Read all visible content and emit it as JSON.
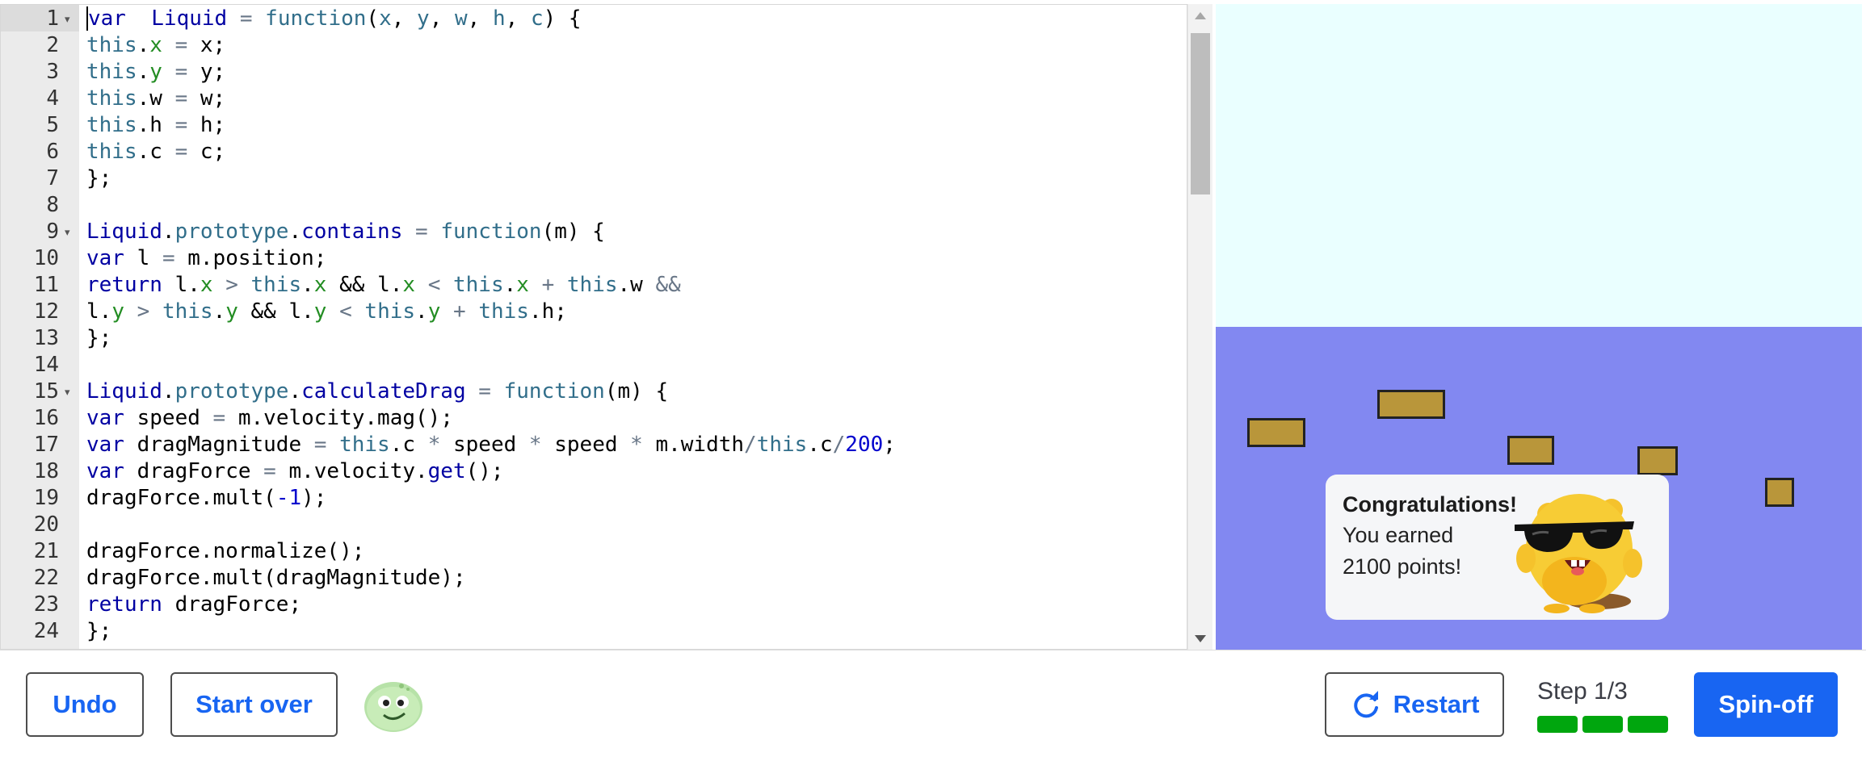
{
  "editor": {
    "lines": [
      {
        "n": "1",
        "fold": true
      },
      {
        "n": "2"
      },
      {
        "n": "3"
      },
      {
        "n": "4"
      },
      {
        "n": "5"
      },
      {
        "n": "6"
      },
      {
        "n": "7"
      },
      {
        "n": "8"
      },
      {
        "n": "9",
        "fold": true
      },
      {
        "n": "10"
      },
      {
        "n": "11"
      },
      {
        "n": "12"
      },
      {
        "n": "13"
      },
      {
        "n": "14"
      },
      {
        "n": "15",
        "fold": true
      },
      {
        "n": "16"
      },
      {
        "n": "17"
      },
      {
        "n": "18"
      },
      {
        "n": "19"
      },
      {
        "n": "20"
      },
      {
        "n": "21"
      },
      {
        "n": "22"
      },
      {
        "n": "23"
      },
      {
        "n": "24"
      }
    ],
    "code": [
      [
        [
          "kw",
          "var"
        ],
        [
          "",
          "  "
        ],
        [
          "fn",
          "Liquid"
        ],
        [
          "",
          " "
        ],
        [
          "op",
          "="
        ],
        [
          "",
          " "
        ],
        [
          "st",
          "function"
        ],
        [
          "",
          "("
        ],
        [
          "st",
          "x"
        ],
        [
          "",
          ", "
        ],
        [
          "st",
          "y"
        ],
        [
          "",
          ", "
        ],
        [
          "st",
          "w"
        ],
        [
          "",
          ", "
        ],
        [
          "st",
          "h"
        ],
        [
          "",
          ", "
        ],
        [
          "st",
          "c"
        ],
        [
          "",
          ") {"
        ]
      ],
      [
        [
          "st",
          "this"
        ],
        [
          "",
          "."
        ],
        [
          "pr",
          "x"
        ],
        [
          "",
          " "
        ],
        [
          "op",
          "="
        ],
        [
          "",
          " x;"
        ]
      ],
      [
        [
          "st",
          "this"
        ],
        [
          "",
          "."
        ],
        [
          "pr",
          "y"
        ],
        [
          "",
          " "
        ],
        [
          "op",
          "="
        ],
        [
          "",
          " y;"
        ]
      ],
      [
        [
          "st",
          "this"
        ],
        [
          "",
          ".w "
        ],
        [
          "op",
          "="
        ],
        [
          "",
          " w;"
        ]
      ],
      [
        [
          "st",
          "this"
        ],
        [
          "",
          ".h "
        ],
        [
          "op",
          "="
        ],
        [
          "",
          " h;"
        ]
      ],
      [
        [
          "st",
          "this"
        ],
        [
          "",
          ".c "
        ],
        [
          "op",
          "="
        ],
        [
          "",
          " c;"
        ]
      ],
      [
        [
          "",
          "};"
        ]
      ],
      [
        [
          "",
          ""
        ]
      ],
      [
        [
          "fn",
          "Liquid"
        ],
        [
          "",
          "."
        ],
        [
          "st",
          "prototype"
        ],
        [
          "",
          "."
        ],
        [
          "fn",
          "contains"
        ],
        [
          "",
          " "
        ],
        [
          "op",
          "="
        ],
        [
          "",
          " "
        ],
        [
          "st",
          "function"
        ],
        [
          "",
          "(m) {"
        ]
      ],
      [
        [
          "kw",
          "var"
        ],
        [
          "",
          " l "
        ],
        [
          "op",
          "="
        ],
        [
          "",
          " m.position;"
        ]
      ],
      [
        [
          "kw",
          "return"
        ],
        [
          "",
          " l."
        ],
        [
          "pr",
          "x"
        ],
        [
          "",
          " "
        ],
        [
          "op",
          ">"
        ],
        [
          "",
          " "
        ],
        [
          "st",
          "this"
        ],
        [
          "",
          "."
        ],
        [
          "pr",
          "x"
        ],
        [
          "",
          " && l."
        ],
        [
          "pr",
          "x"
        ],
        [
          "",
          " "
        ],
        [
          "op",
          "<"
        ],
        [
          "",
          " "
        ],
        [
          "st",
          "this"
        ],
        [
          "",
          "."
        ],
        [
          "pr",
          "x"
        ],
        [
          "",
          " "
        ],
        [
          "op",
          "+"
        ],
        [
          "",
          " "
        ],
        [
          "st",
          "this"
        ],
        [
          "",
          ".w "
        ],
        [
          "op",
          "&&"
        ]
      ],
      [
        [
          "",
          "l."
        ],
        [
          "pr",
          "y"
        ],
        [
          "",
          " "
        ],
        [
          "op",
          ">"
        ],
        [
          "",
          " "
        ],
        [
          "st",
          "this"
        ],
        [
          "",
          "."
        ],
        [
          "pr",
          "y"
        ],
        [
          "",
          " && l."
        ],
        [
          "pr",
          "y"
        ],
        [
          "",
          " "
        ],
        [
          "op",
          "<"
        ],
        [
          "",
          " "
        ],
        [
          "st",
          "this"
        ],
        [
          "",
          "."
        ],
        [
          "pr",
          "y"
        ],
        [
          "",
          " "
        ],
        [
          "op",
          "+"
        ],
        [
          "",
          " "
        ],
        [
          "st",
          "this"
        ],
        [
          "",
          ".h;"
        ]
      ],
      [
        [
          "",
          "};"
        ]
      ],
      [
        [
          "",
          ""
        ]
      ],
      [
        [
          "fn",
          "Liquid"
        ],
        [
          "",
          "."
        ],
        [
          "st",
          "prototype"
        ],
        [
          "",
          "."
        ],
        [
          "fn",
          "calculateDrag"
        ],
        [
          "",
          " "
        ],
        [
          "op",
          "="
        ],
        [
          "",
          " "
        ],
        [
          "st",
          "function"
        ],
        [
          "",
          "(m) {"
        ]
      ],
      [
        [
          "kw",
          "var"
        ],
        [
          "",
          " speed "
        ],
        [
          "op",
          "="
        ],
        [
          "",
          " m.velocity.mag();"
        ]
      ],
      [
        [
          "kw",
          "var"
        ],
        [
          "",
          " dragMagnitude "
        ],
        [
          "op",
          "="
        ],
        [
          "",
          " "
        ],
        [
          "st",
          "this"
        ],
        [
          "",
          ".c "
        ],
        [
          "op",
          "*"
        ],
        [
          "",
          " speed "
        ],
        [
          "op",
          "*"
        ],
        [
          "",
          " speed "
        ],
        [
          "op",
          "*"
        ],
        [
          "",
          " m.width"
        ],
        [
          "op",
          "/"
        ],
        [
          "st",
          "this"
        ],
        [
          "",
          ".c"
        ],
        [
          "op",
          "/"
        ],
        [
          "nu",
          "200"
        ],
        [
          "",
          ";"
        ]
      ],
      [
        [
          "kw",
          "var"
        ],
        [
          "",
          " dragForce "
        ],
        [
          "op",
          "="
        ],
        [
          "",
          " m.velocity."
        ],
        [
          "fn",
          "get"
        ],
        [
          "",
          "();"
        ]
      ],
      [
        [
          "",
          "dragForce.mult("
        ],
        [
          "nu",
          "-1"
        ],
        [
          "",
          ");"
        ]
      ],
      [
        [
          "",
          ""
        ]
      ],
      [
        [
          "",
          "dragForce.normalize();"
        ]
      ],
      [
        [
          "",
          "dragForce.mult(dragMagnitude);"
        ]
      ],
      [
        [
          "kw",
          "return"
        ],
        [
          "",
          " dragForce;"
        ]
      ],
      [
        [
          "",
          "};"
        ]
      ]
    ]
  },
  "canvas": {
    "liquid_color": "#8288f1",
    "sky_color": "#eaffff",
    "mover_color": "#b9963a"
  },
  "congrats": {
    "title": "Congratulations!",
    "line1": "You earned",
    "line2": "2100 points!"
  },
  "toolbar": {
    "undo_label": "Undo",
    "startover_label": "Start over",
    "restart_label": "Restart",
    "step_label": "Step 1/3",
    "spinoff_label": "Spin-off",
    "progress_segments": 3,
    "progress_complete": 3
  }
}
